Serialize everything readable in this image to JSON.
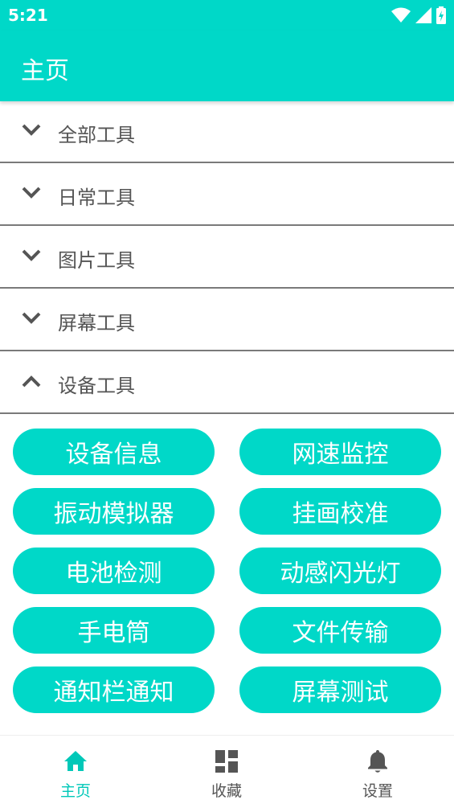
{
  "status": {
    "time": "5:21"
  },
  "appbar": {
    "title": "主页"
  },
  "sections": [
    {
      "label": "全部工具",
      "expanded": false
    },
    {
      "label": "日常工具",
      "expanded": false
    },
    {
      "label": "图片工具",
      "expanded": false
    },
    {
      "label": "屏幕工具",
      "expanded": false
    },
    {
      "label": "设备工具",
      "expanded": true
    }
  ],
  "tools": [
    "设备信息",
    "网速监控",
    "振动模拟器",
    "挂画校准",
    "电池检测",
    "动感闪光灯",
    "手电筒",
    "文件传输",
    "通知栏通知",
    "屏幕测试"
  ],
  "nav": [
    {
      "label": "主页",
      "active": true
    },
    {
      "label": "收藏",
      "active": false
    },
    {
      "label": "设置",
      "active": false
    }
  ],
  "colors": {
    "accent": "#00D8C8",
    "active_nav": "#00C8B8",
    "inactive_nav": "#555555"
  }
}
